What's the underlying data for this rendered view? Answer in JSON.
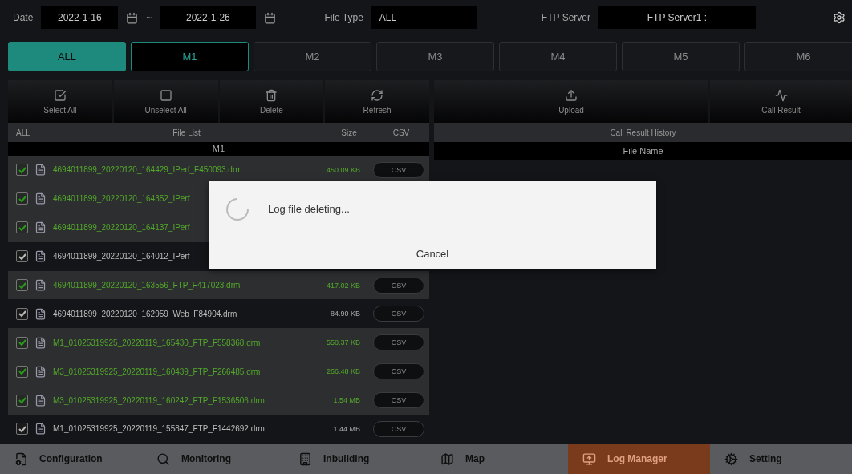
{
  "filter_bar": {
    "date_label": "Date",
    "date_from": "2022-1-16",
    "separator": "~",
    "date_to": "2022-1-26",
    "file_type_label": "File Type",
    "file_type": "ALL",
    "ftp_label": "FTP Server",
    "ftp_server": "FTP Server1 :"
  },
  "tabs": [
    {
      "label": "ALL",
      "selected": true,
      "outlined": false
    },
    {
      "label": "M1",
      "selected": false,
      "outlined": true
    },
    {
      "label": "M2",
      "selected": false,
      "outlined": false
    },
    {
      "label": "M3",
      "selected": false,
      "outlined": false
    },
    {
      "label": "M4",
      "selected": false,
      "outlined": false
    },
    {
      "label": "M5",
      "selected": false,
      "outlined": false
    },
    {
      "label": "M6",
      "selected": false,
      "outlined": false
    }
  ],
  "file_actions": [
    {
      "kind": "check",
      "label": "Select All"
    },
    {
      "kind": "box",
      "label": "Unselect All"
    },
    {
      "kind": "trash",
      "label": "Delete"
    },
    {
      "kind": "refresh",
      "label": "Refresh"
    }
  ],
  "file_list": {
    "columns": [
      "ALL",
      "File List",
      "Size",
      "CSV"
    ],
    "group": "M1",
    "rows": [
      {
        "name": "4694011899_20220120_164429_IPerf_F450093.drm",
        "size": "450.09 KB",
        "csv": "CSV",
        "checked": true,
        "selected": true
      },
      {
        "name": "4694011899_20220120_164352_IPerf",
        "checked": true,
        "selected": true
      },
      {
        "name": "4694011899_20220120_164137_IPerf",
        "checked": true,
        "selected": true
      },
      {
        "name": "4694011899_20220120_164012_IPerf",
        "checked": true,
        "selected": false
      },
      {
        "name": "4694011899_20220120_163556_FTP_F417023.drm",
        "size": "417.02 KB",
        "csv": "CSV",
        "checked": true,
        "selected": true
      },
      {
        "name": "4694011899_20220120_162959_Web_F84904.drm",
        "size": "84.90 KB",
        "csv": "CSV",
        "checked": true,
        "selected": false
      },
      {
        "name": "M1_01025319925_20220119_165430_FTP_F558368.drm",
        "size": "558.37 KB",
        "csv": "CSV",
        "checked": true,
        "selected": true
      },
      {
        "name": "M3_01025319925_20220119_160439_FTP_F266485.drm",
        "size": "266.48 KB",
        "csv": "CSV",
        "checked": true,
        "selected": true
      },
      {
        "name": "M3_01025319925_20220119_160242_FTP_F1536506.drm",
        "size": "1.54 MB",
        "csv": "CSV",
        "checked": true,
        "selected": true
      },
      {
        "name": "M1_01025319925_20220119_155847_FTP_F1442692.drm",
        "size": "1.44 MB",
        "csv": "CSV",
        "checked": true,
        "selected": false
      }
    ]
  },
  "result_actions": [
    {
      "kind": "upload",
      "label": "Upload"
    },
    {
      "kind": "pulse",
      "label": "Call Result"
    }
  ],
  "call_result": {
    "title": "Call Result History",
    "column": "File Name"
  },
  "dialog": {
    "message": "Log file deleting...",
    "button": "Cancel"
  },
  "nav": [
    {
      "kind": "config",
      "label": "Configuration",
      "selected": false
    },
    {
      "kind": "search",
      "label": "Monitoring",
      "selected": false
    },
    {
      "kind": "building",
      "label": "Inbuilding",
      "selected": false
    },
    {
      "kind": "map",
      "label": "Map",
      "selected": false
    },
    {
      "kind": "log",
      "label": "Log Manager",
      "selected": true
    },
    {
      "kind": "settings",
      "label": "Setting",
      "selected": false
    }
  ]
}
